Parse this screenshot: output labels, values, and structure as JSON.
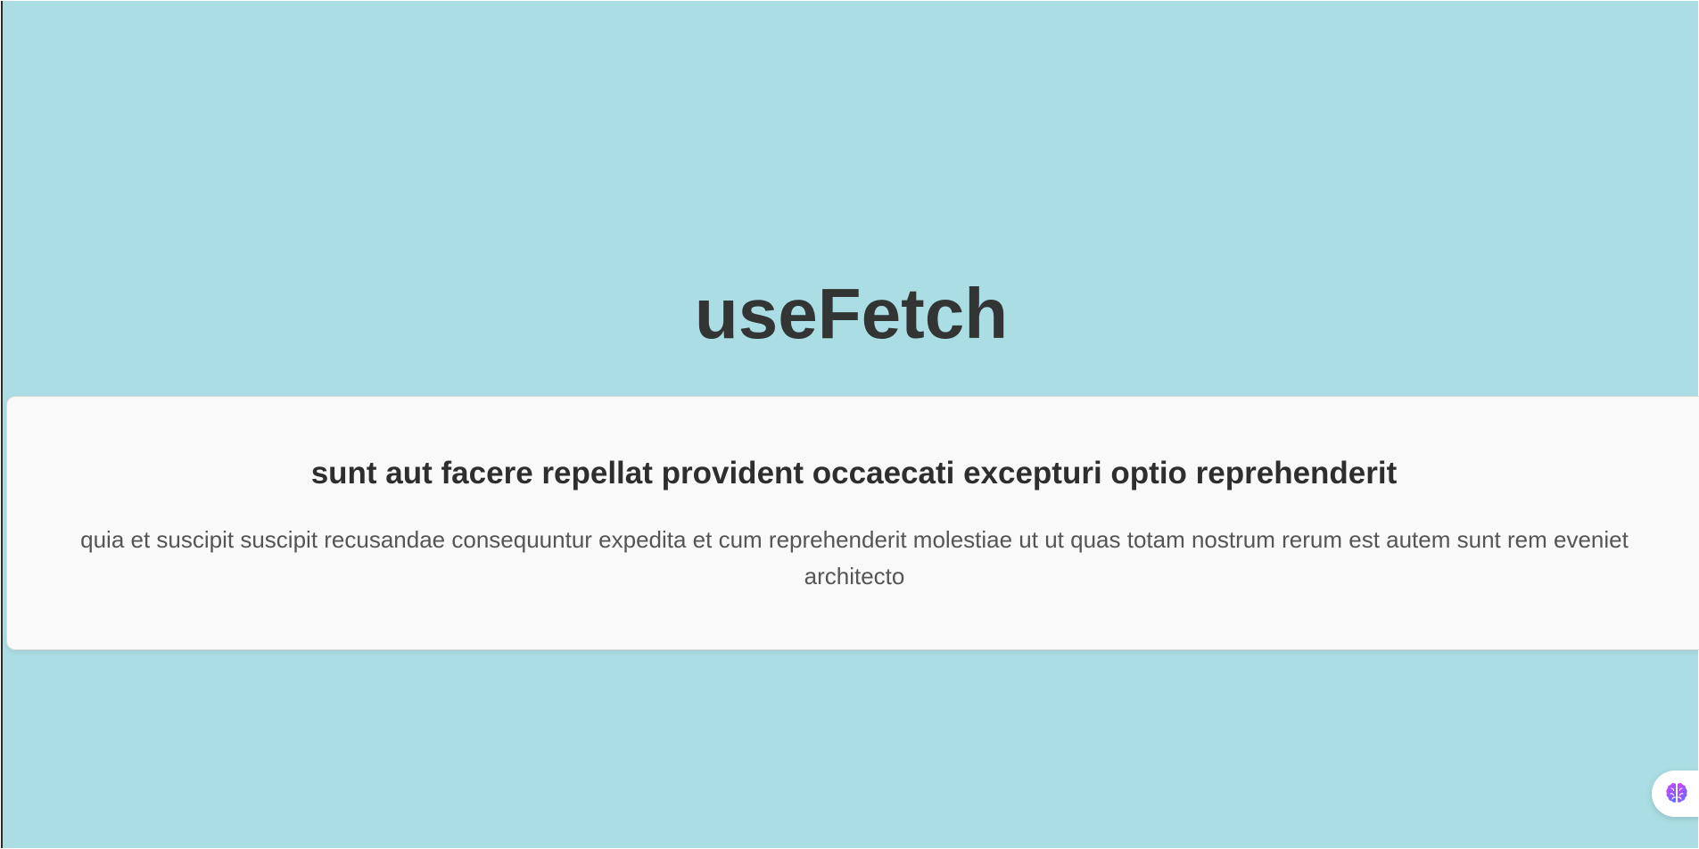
{
  "header": {
    "title": "useFetch"
  },
  "post": {
    "title": "sunt aut facere repellat provident occaecati excepturi optio reprehenderit",
    "body": "quia et suscipit suscipit recusandae consequuntur expedita et cum reprehenderit molestiae ut ut quas totam nostrum rerum est autem sunt rem eveniet architecto"
  },
  "widget": {
    "icon": "brain-icon"
  },
  "colors": {
    "background": "#abdee4",
    "card": "#f9f9f9",
    "title_text": "#333535",
    "body_text": "#555555",
    "icon_gradient_start": "#e040fb",
    "icon_gradient_end": "#536dfe"
  }
}
